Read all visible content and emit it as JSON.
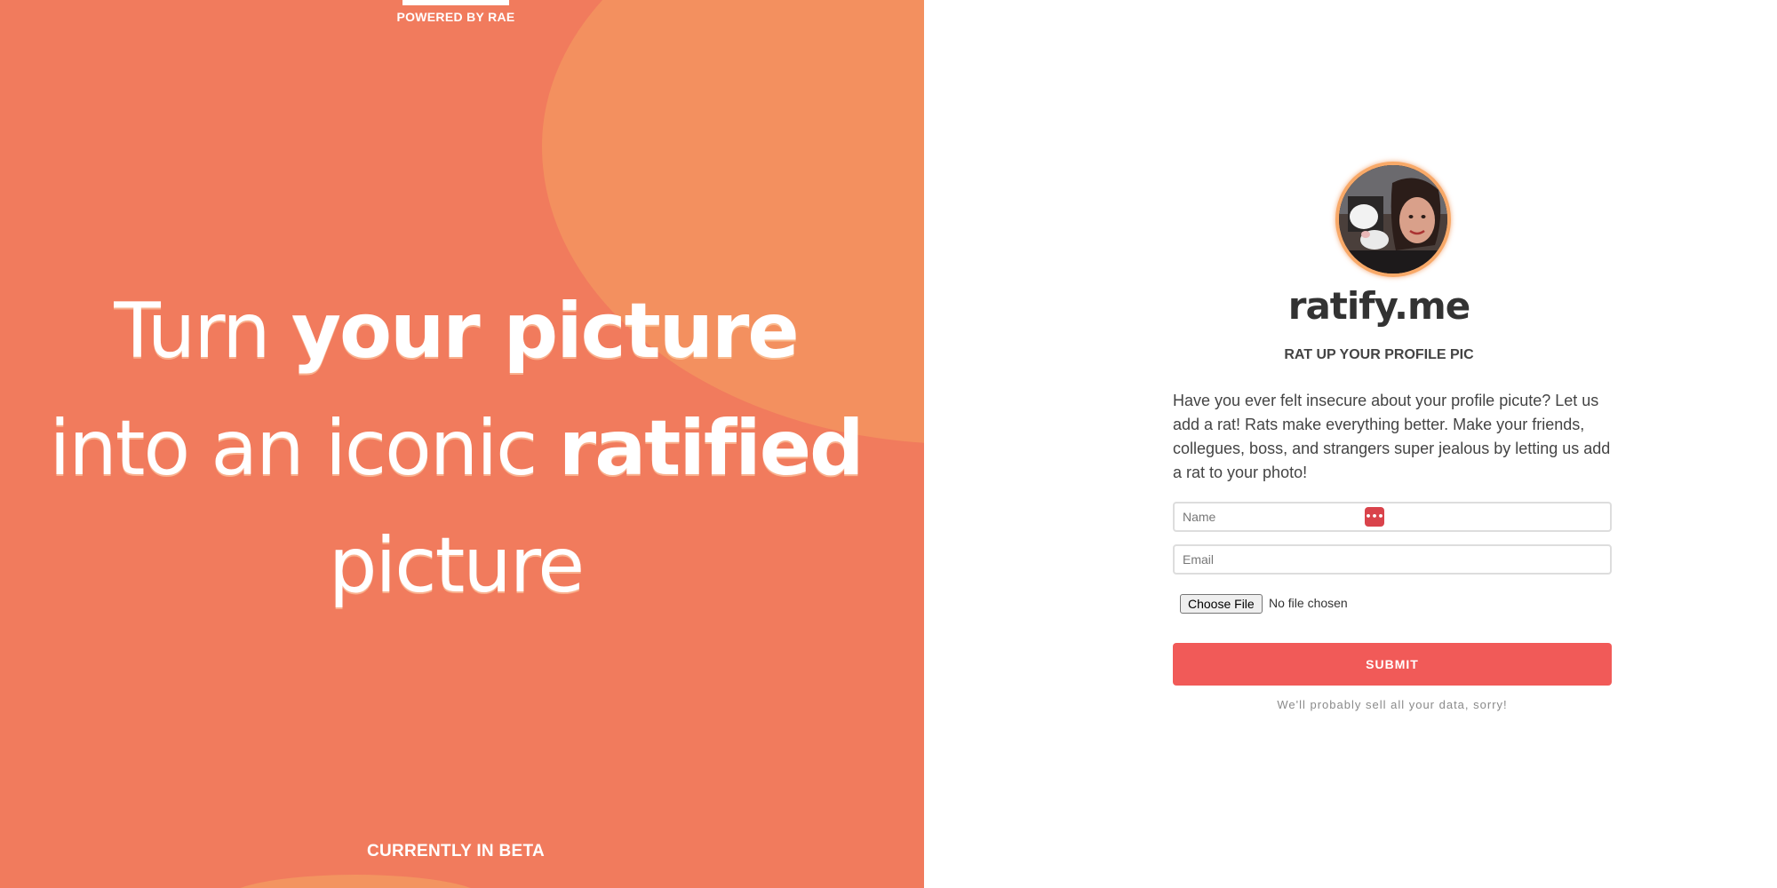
{
  "hero": {
    "powered_by": "POWERED BY RAE",
    "headline": {
      "line1_light": "Turn ",
      "line1_bold": "your picture",
      "line2_light": "into an iconic ",
      "line2_bold": "ratified",
      "line3_light": "picture"
    },
    "beta": "CURRENTLY IN BETA",
    "colors": {
      "background": "#f17b5d",
      "blob": "#f3905f"
    }
  },
  "panel": {
    "avatar_icon": "profile-photo",
    "brand": "ratify.me",
    "tagline": "RAT UP YOUR PROFILE PIC",
    "blurb": "Have you ever felt insecure about your profile picute? Let us add a rat! Rats make everything better. Make your friends, collegues, boss, and strangers super jealous by letting us add a rat to your photo!",
    "form": {
      "name_placeholder": "Name",
      "email_placeholder": "Email",
      "password_manager_icon": "password-manager-icon",
      "file_button": "Choose File",
      "file_status": "No file chosen",
      "submit": "SUBMIT"
    },
    "disclaimer": "We'll probably sell all your data, sorry!",
    "colors": {
      "submit": "#f15a58",
      "text": "#444444",
      "avatar_ring": "#f8a968"
    }
  }
}
